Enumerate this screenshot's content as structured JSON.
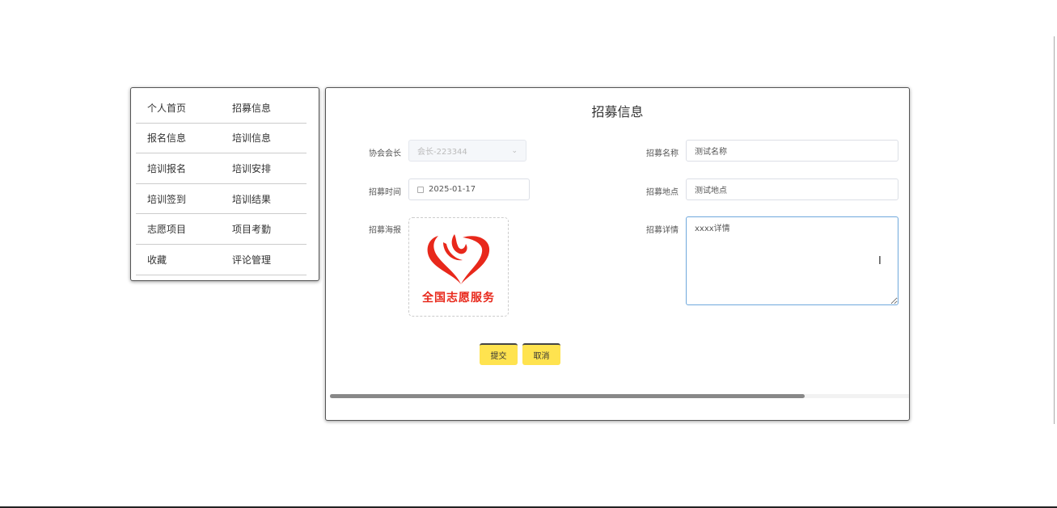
{
  "menu": {
    "rows": [
      [
        "个人首页",
        "招募信息"
      ],
      [
        "报名信息",
        "培训信息"
      ],
      [
        "培训报名",
        "培训安排"
      ],
      [
        "培训签到",
        "培训结果"
      ],
      [
        "志愿项目",
        "项目考勤"
      ],
      [
        "收藏",
        "评论管理"
      ]
    ]
  },
  "form": {
    "title": "招募信息",
    "president_label": "协会会长",
    "president_value": "会长-223344",
    "time_label": "招募时间",
    "time_value": "2025-01-17",
    "poster_label": "招募海报",
    "poster_text": "全国志愿服务",
    "name_label": "招募名称",
    "name_value": "测试名称",
    "place_label": "招募地点",
    "place_value": "测试地点",
    "detail_label": "招募详情",
    "detail_value": "xxxx详情",
    "submit": "提交",
    "cancel": "取消",
    "scroll_fraction": 0.82,
    "accent": "#ffe34f",
    "logo_red": "#e8281b"
  }
}
